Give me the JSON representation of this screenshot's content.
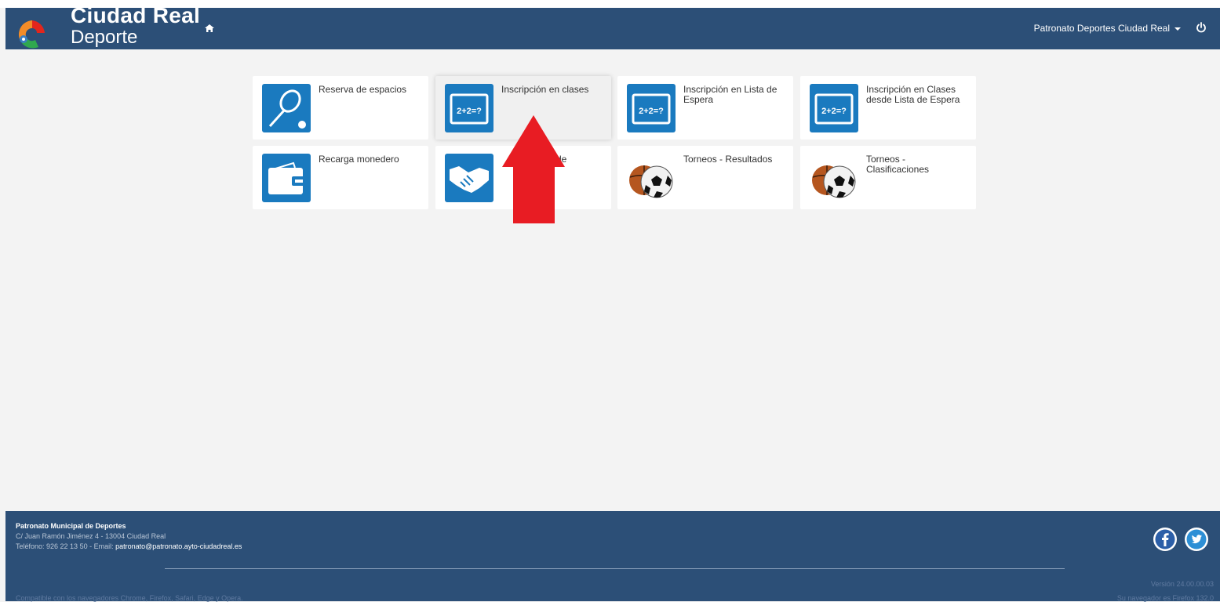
{
  "header": {
    "brand_title": "Ciudad Real",
    "brand_subtitle": "Deporte",
    "user_menu_label": "Patronato Deportes Ciudad Real",
    "icons": [
      "logo",
      "home-icon",
      "chevron-down-icon",
      "power-icon"
    ]
  },
  "tiles": [
    {
      "label": "Reserva de espacios",
      "icon": "tennis-racket-icon"
    },
    {
      "label": "Inscripción en clases",
      "icon": "blackboard-icon",
      "active": true
    },
    {
      "label": "Inscripción en Lista de Espera",
      "icon": "blackboard-icon"
    },
    {
      "label": "Inscripción en Clases desde Lista de Espera",
      "icon": "blackboard-icon"
    },
    {
      "label": "Recarga monedero",
      "icon": "wallet-icon"
    },
    {
      "label": "de",
      "icon": "handshake-icon"
    },
    {
      "label": "Torneos - Resultados",
      "icon": "balls-icon"
    },
    {
      "label": "Torneos - Clasificaciones",
      "icon": "balls-icon"
    }
  ],
  "annotation": {
    "type": "red-arrow-up",
    "color": "#e81c23"
  },
  "footer": {
    "org_name": "Patronato Municipal de Deportes",
    "address": "C/ Juan Ramón Jiménez 4 - 13004 Ciudad Real",
    "phone_prefix": "Teléfono: 926 22 13 50 - Email: ",
    "email": "patronato@patronato.ayto-ciudadreal.es",
    "compatibility": "Compatible con los navegadores Chrome, Firefox, Safari, Edge y Opera.",
    "version": "Versión 24.00.00.03",
    "browser": "Su navegador es Firefox 132.0",
    "social": [
      "facebook-icon",
      "twitter-icon"
    ]
  },
  "colors": {
    "header_bg": "#2c4f77",
    "tile_icon_blue": "#1a7abf",
    "page_bg": "#f3f3f3",
    "arrow_red": "#e81c23"
  }
}
